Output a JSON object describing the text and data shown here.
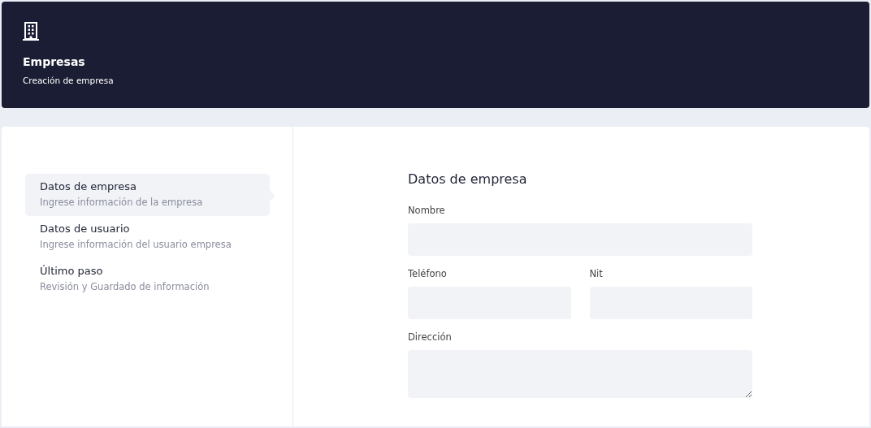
{
  "header": {
    "title": "Empresas",
    "subtitle": "Creación de empresa"
  },
  "steps": [
    {
      "title": "Datos de empresa",
      "description": "Ingrese información de la empresa",
      "selected": true
    },
    {
      "title": "Datos de usuario",
      "description": "Ingrese información del usuario empresa",
      "selected": false
    },
    {
      "title": "Último paso",
      "description": "Revisión y Guardado de información",
      "selected": false
    }
  ],
  "form": {
    "title": "Datos de empresa",
    "rows": [
      [
        {
          "label": "Nombre",
          "kind": "input"
        }
      ],
      [
        {
          "label": "Teléfono",
          "kind": "input"
        },
        {
          "label": "Nit",
          "kind": "input"
        }
      ],
      [
        {
          "label": "Dirección",
          "kind": "textarea"
        }
      ]
    ]
  }
}
